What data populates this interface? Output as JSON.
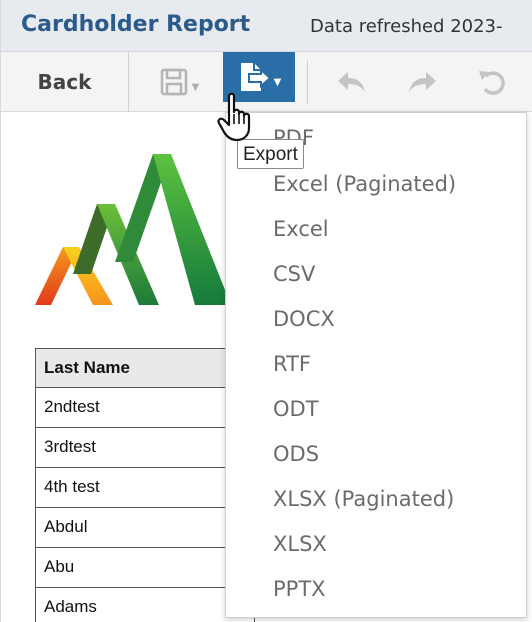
{
  "header": {
    "title": "Cardholder Report",
    "refreshed": "Data refreshed 2023-"
  },
  "toolbar": {
    "back_label": "Back",
    "save_icon": "floppy-disk-icon",
    "export_icon": "export-document-icon",
    "undo_icon": "undo-icon",
    "redo_icon": "redo-icon",
    "refresh_icon": "reset-icon",
    "export_color": "#2a6ea8"
  },
  "tooltip": {
    "text": "Export"
  },
  "export_menu": {
    "items": [
      "PDF",
      "Excel (Paginated)",
      "Excel",
      "CSV",
      "DOCX",
      "RTF",
      "ODT",
      "ODS",
      "XLSX (Paginated)",
      "XLSX",
      "PPTX"
    ]
  },
  "table": {
    "header": "Last Name",
    "rows": [
      "2ndtest",
      "3rdtest",
      "4th test",
      "Abdul",
      "Abu",
      "Adams"
    ]
  },
  "colors": {
    "title": "#2c5a8a",
    "header_bg": "#e7ebef",
    "toolbar_bg": "#f4f4f4",
    "menu_text": "#6b6b6b"
  }
}
